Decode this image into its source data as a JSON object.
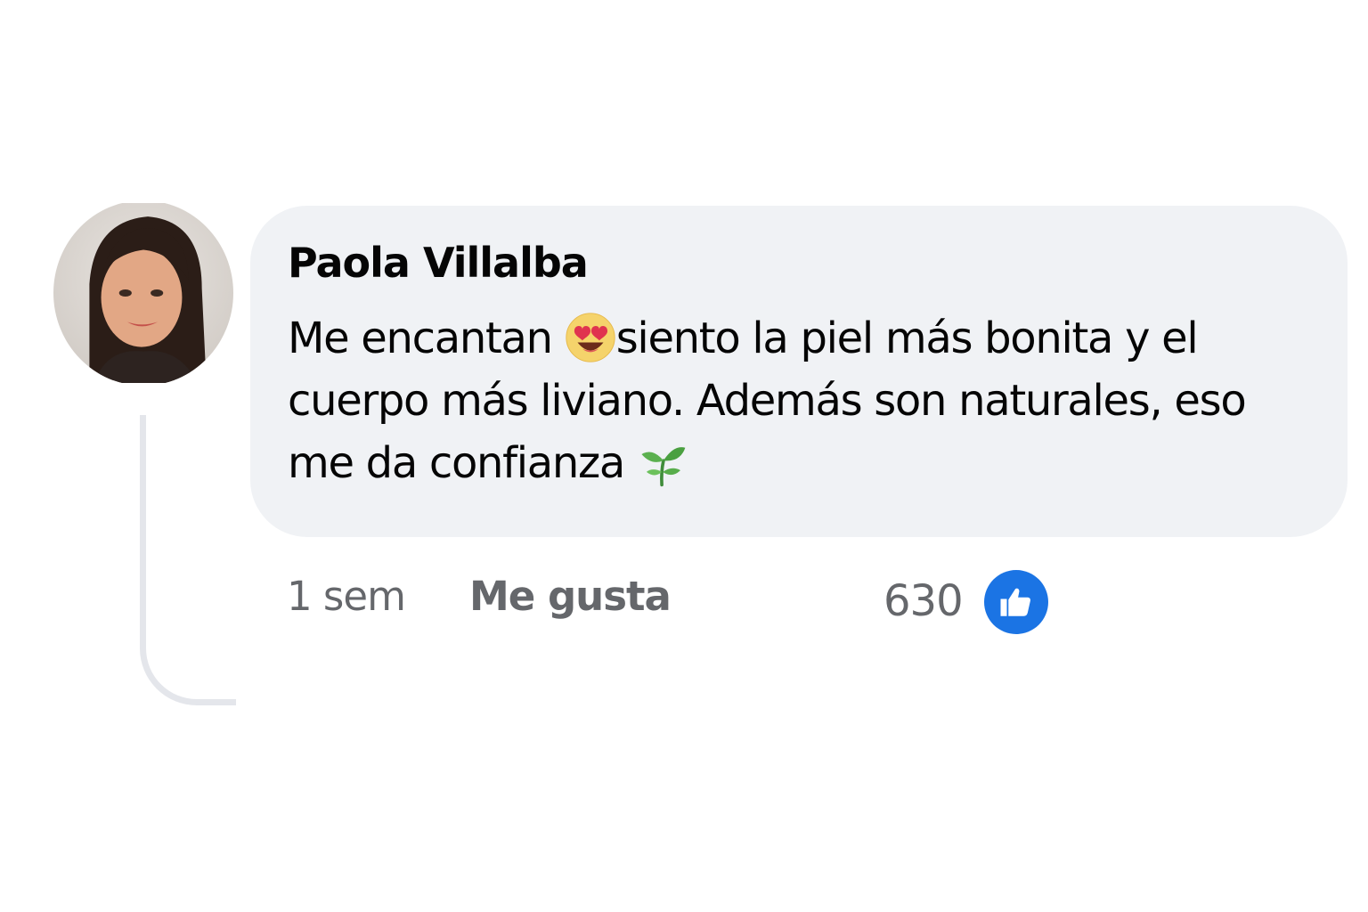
{
  "comment": {
    "author": "Paola Villalba",
    "text_before_emoji": "Me encantan ",
    "emoji_1": "smiling-face-with-heart-eyes-icon",
    "text_after_emoji": "siento la piel más bonita y el cuerpo más liviano. Además son naturales, eso me da confianza ",
    "emoji_2": "seedling-icon"
  },
  "actions": {
    "time": "1 sem",
    "like_label": "Me gusta",
    "reaction_count": "630",
    "reaction_icon": "thumbs-up-icon"
  },
  "colors": {
    "bubble": "#f0f2f5",
    "name_text": "#050505",
    "meta_text": "#65676b",
    "like_blue": "#1b74e4",
    "thread_line": "#e4e6eb"
  }
}
